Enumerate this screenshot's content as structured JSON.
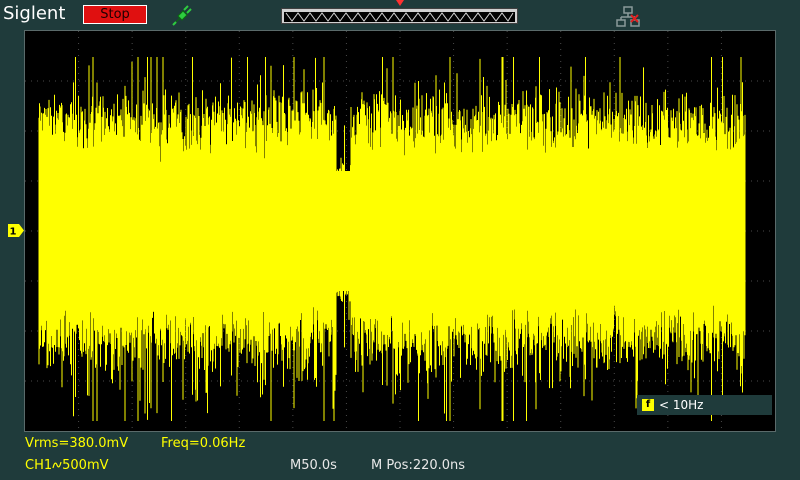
{
  "header": {
    "brand": "Siglent",
    "run_state_label": "Stop",
    "run_state_color": "#e01010",
    "icons": [
      "probe-icon",
      "trigger-position-marker",
      "network-icon"
    ]
  },
  "display": {
    "trace_color": "#ffff00",
    "grid_color": "#4a4a4a",
    "channel_marker": "1"
  },
  "trigger_freq_counter": {
    "icon_label": "f",
    "value": "< 10Hz"
  },
  "measurements": {
    "vrms": "Vrms=380.0mV",
    "freq": "Freq=0.06Hz"
  },
  "status": {
    "channel": "CH1",
    "coupling_icon": "ac-coupling-icon",
    "volts_per_div": "500mV",
    "timebase": "M50.0s",
    "position": "M Pos:220.0ns"
  }
}
